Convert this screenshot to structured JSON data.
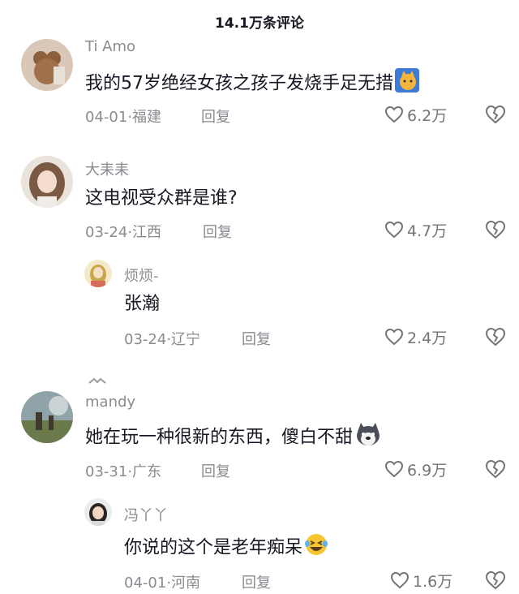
{
  "header": {
    "title": "14.1万条评论"
  },
  "comments": [
    {
      "username": "Ti Amo",
      "text": "我的57岁绝经女孩之孩子发烧手足无措",
      "date": "04-01",
      "location": "福建",
      "reply_label": "回复",
      "likes": "6.2万",
      "emoji": "cat-emoji"
    },
    {
      "username": "大耒耒",
      "text": "这电视受众群是谁?",
      "date": "03-24",
      "location": "江西",
      "reply_label": "回复",
      "likes": "4.7万",
      "reply": {
        "username": "烦烦-",
        "text": "张瀚",
        "date": "03-24",
        "location": "辽宁",
        "reply_label": "回复",
        "likes": "2.4万"
      }
    },
    {
      "username": "mandy",
      "text": "她在玩一种很新的东西，傻白不甜",
      "date": "03-31",
      "location": "广东",
      "reply_label": "回复",
      "likes": "6.9万",
      "emoji": "husky-emoji",
      "reply": {
        "username": "冯丫丫",
        "text": "你说的这个是老年痴呆",
        "date": "04-01",
        "location": "河南",
        "reply_label": "回复",
        "likes": "1.6万",
        "emoji": "laugh-cry-emoji"
      }
    }
  ],
  "colors": {
    "text": "#161823",
    "muted": "#8a8b91",
    "icon": "#737378"
  }
}
